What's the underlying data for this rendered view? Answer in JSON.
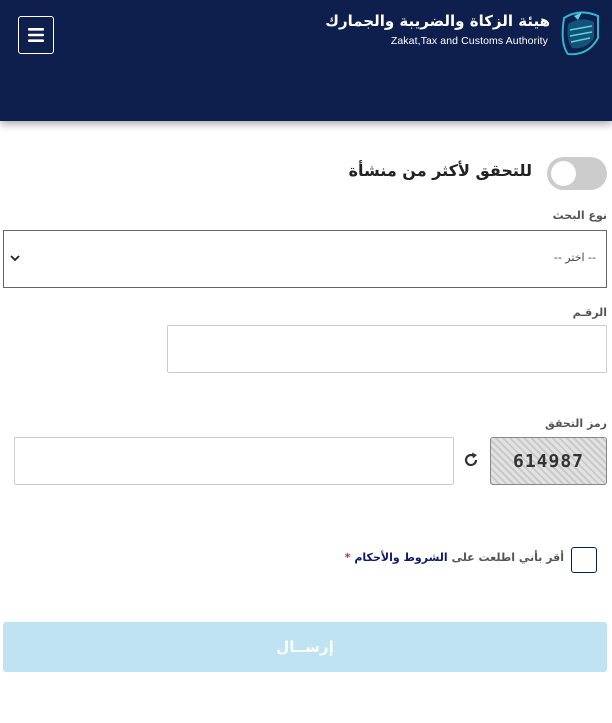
{
  "header": {
    "org_name_ar": "هيئة الزكاة والضريبة والجمارك",
    "org_name_en": "Zakat,Tax and Customs Authority",
    "menu_icon": "hamburger-icon",
    "logo_icon": "zatca-logo-icon",
    "bg_color": "#0e1f4e"
  },
  "form": {
    "multi_toggle": {
      "label": "للتحقق لأكثر من منشأة",
      "state": "off"
    },
    "search_type": {
      "label": "نوع البحث",
      "selected": "-- اختر --"
    },
    "number": {
      "label": "الرقـم",
      "value": ""
    },
    "captcha": {
      "label": "رمز التحقق",
      "code": "614987",
      "refresh_icon": "refresh-icon",
      "value": ""
    },
    "terms": {
      "prefix": "أقر بأني اطلعت على",
      "link": "الشروط والأحكام",
      "required_mark": "*",
      "checked": false
    },
    "submit_label": "إرســال",
    "submit_color": "#bfe3f3"
  }
}
